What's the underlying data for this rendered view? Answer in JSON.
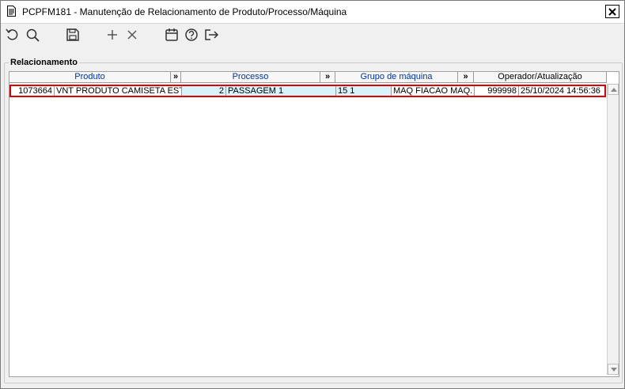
{
  "window": {
    "title": "PCPFM181 - Manutenção de Relacionamento de Produto/Processo/Máquina"
  },
  "toolbar": {
    "icons": [
      "refresh-icon",
      "search-icon",
      "save-icon",
      "add-icon",
      "delete-icon",
      "calendar-icon",
      "help-icon",
      "exit-icon"
    ]
  },
  "group": {
    "label": "Relacionamento"
  },
  "grid": {
    "headers": {
      "produto": "Produto",
      "expand1": "»",
      "processo": "Processo",
      "expand2": "»",
      "grupo": "Grupo de máquina",
      "expand3": "»",
      "operador": "Operador/Atualização"
    },
    "rows": [
      {
        "produto_code": "1073664",
        "produto_desc": "VNT PRODUTO CAMISETA ESTAM",
        "processo_code": "2",
        "processo_desc": "PASSAGEM 1",
        "grupo_code": "15 1",
        "grupo_desc": "MAQ FIACAO MAQ. F",
        "operador": "999998",
        "atualizacao": "25/10/2024 14:56:36"
      }
    ]
  },
  "colors": {
    "selection_border": "#e00000",
    "highlight_cell": "#d9f3fb",
    "header_text": "#003399"
  }
}
